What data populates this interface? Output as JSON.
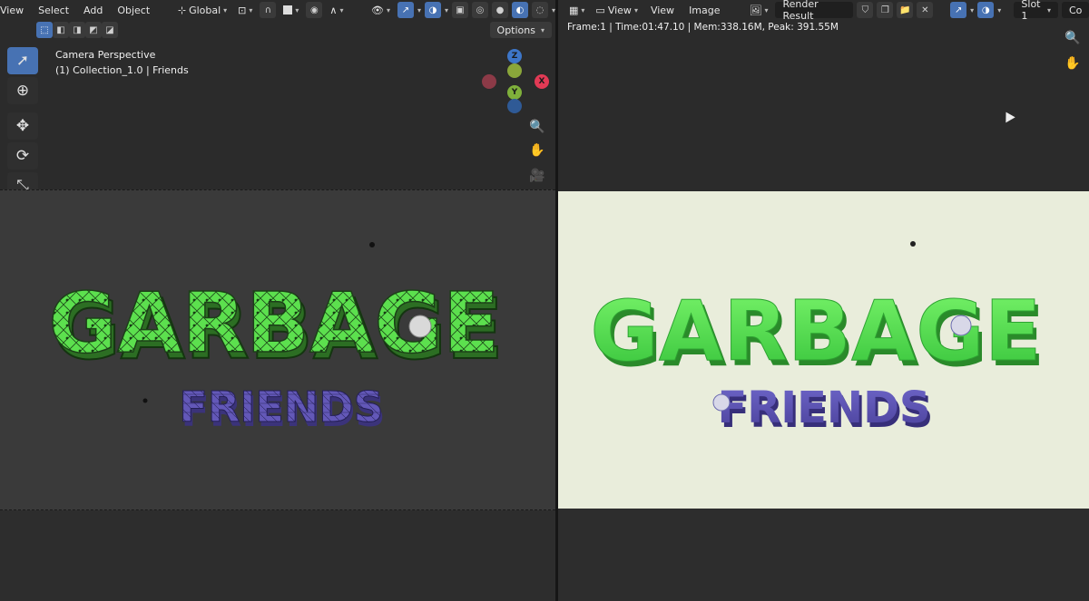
{
  "left": {
    "menu": [
      "View",
      "Select",
      "Add",
      "Object"
    ],
    "transform_orientation": "Global",
    "options_label": "Options",
    "viewport_title": "Camera Perspective",
    "viewport_subtitle": "(1) Collection_1.0 | Friends",
    "axes": {
      "z": "Z",
      "y": "Y",
      "x": "X"
    }
  },
  "right": {
    "menu": [
      "View",
      "View",
      "Image"
    ],
    "image_name": "Render Result",
    "slot": "Slot 1",
    "composite_trunc": "Co",
    "stats": "Frame:1 | Time:01:47.10 | Mem:338.16M, Peak: 391.55M"
  },
  "artwork": {
    "title": "GARBAGE",
    "subtitle": "FRIENDS"
  },
  "colors": {
    "accent": "#4772b3",
    "green": "#5fe85a",
    "purple": "#5f56b6",
    "render_bg": "#e9eddb"
  }
}
